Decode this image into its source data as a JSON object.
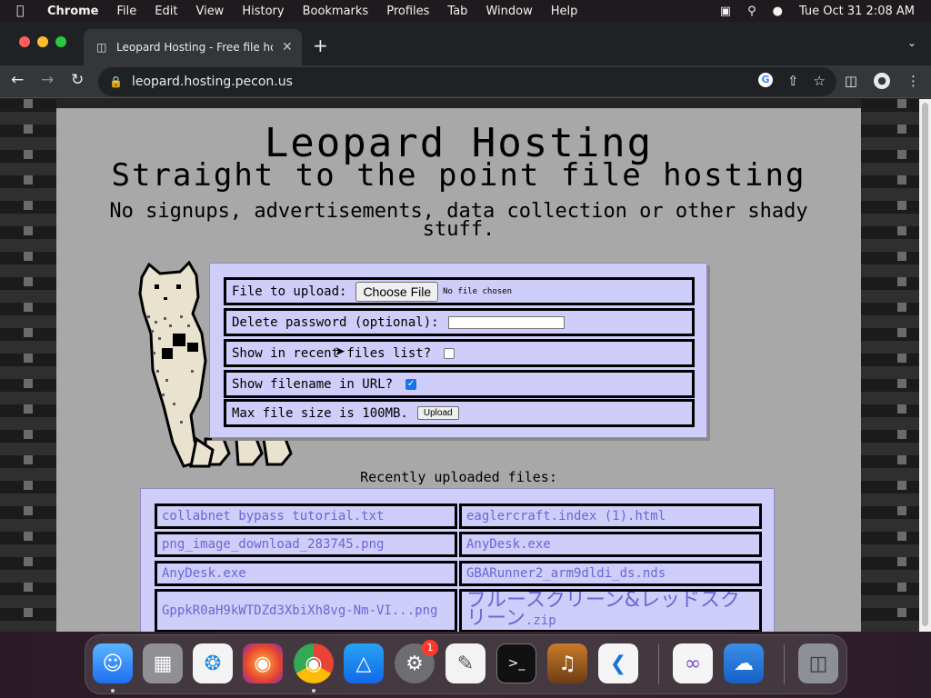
{
  "menubar": {
    "app_name": "Chrome",
    "items": [
      "File",
      "Edit",
      "View",
      "History",
      "Bookmarks",
      "Profiles",
      "Tab",
      "Window",
      "Help"
    ],
    "clock": "Tue Oct 31  2:08 AM"
  },
  "browser": {
    "tab_title": "Leopard Hosting - Free file hosting",
    "url": "leopard.hosting.pecon.us"
  },
  "page": {
    "title": "Leopard Hosting",
    "subtitle": "Straight to the point file hosting",
    "tagline": "No signups, advertisements, data collection or other shady stuff.",
    "form": {
      "file_label": "File to upload:",
      "choose_file_button": "Choose File",
      "no_file_text": "No file chosen",
      "delete_password_label": "Delete password (optional):",
      "show_recent_label": "Show in recent files list?",
      "show_recent_checked": false,
      "show_filename_label": "Show filename in URL?",
      "show_filename_checked": true,
      "max_size_label": "Max file size is 100MB.",
      "upload_button": "Upload"
    },
    "recent_title": "Recently uploaded files:",
    "recent_files": [
      "collabnet bypass tutorial.txt",
      "eaglercraft.index (1).html",
      "png_image_download_283745.png",
      "AnyDesk.exe",
      "AnyDesk.exe",
      "GBARunner2_arm9dldi_ds.nds",
      "GppkR0aH9kWTDZd3XbiXh8vg-Nm-VI...png",
      "ブルースクリーン&レッドスクリーン",
      ".zip"
    ]
  },
  "dock": {
    "settings_badge": "1"
  },
  "colors": {
    "page_bg": "#a8a8a8",
    "panel_bg": "#cfcdf9",
    "link": "#6b66d6"
  }
}
